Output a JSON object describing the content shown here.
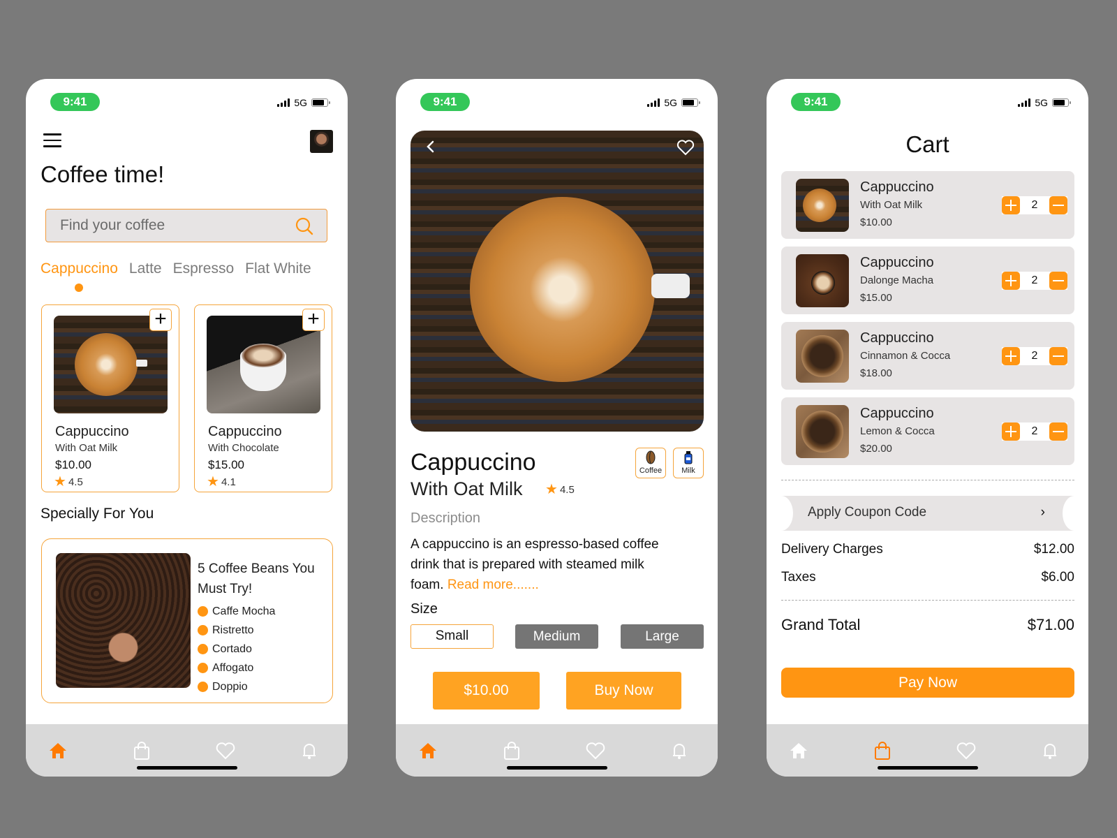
{
  "status_bar": {
    "time": "9:41",
    "network": "5G"
  },
  "colors": {
    "accent": "#ff9512",
    "status_green": "#34c759",
    "card_bg": "#e7e4e4",
    "nav_bg": "#d9d9d9",
    "size_inactive": "#757575"
  },
  "home": {
    "title": "Coffee time!",
    "search": {
      "placeholder": "Find your coffee",
      "value": ""
    },
    "tabs": [
      {
        "label": "Cappuccino",
        "active": true
      },
      {
        "label": "Latte",
        "active": false
      },
      {
        "label": "Espresso",
        "active": false
      },
      {
        "label": "Flat White",
        "active": false
      }
    ],
    "products": [
      {
        "name": "Cappuccino",
        "subtitle": "With Oat Milk",
        "price": "$10.00",
        "rating": "4.5",
        "add_label": "+"
      },
      {
        "name": "Cappuccino",
        "subtitle": "With Chocolate",
        "price": "$15.00",
        "rating": "4.1",
        "add_label": "+"
      }
    ],
    "special_section_title": "Specially For You",
    "special": {
      "title": "5 Coffee Beans You Must Try!",
      "items": [
        "Caffe Mocha",
        "Ristretto",
        "Cortado",
        "Affogato",
        "Doppio"
      ]
    },
    "nav_active": "home"
  },
  "detail": {
    "name": "Cappuccino",
    "subtitle": "With Oat Milk",
    "rating": "4.5",
    "ingredients": [
      {
        "label": "Coffee",
        "icon": "coffee-bean-icon"
      },
      {
        "label": "Milk",
        "icon": "milk-bottle-icon"
      }
    ],
    "description_label": "Description",
    "description": "A cappuccino is an espresso-based coffee drink that  is prepared with steamed milk foam.",
    "read_more": "Read more.......",
    "size_label": "Size",
    "sizes": [
      {
        "label": "Small",
        "selected": true
      },
      {
        "label": "Medium",
        "selected": false
      },
      {
        "label": "Large",
        "selected": false
      }
    ],
    "price_button": "$10.00",
    "buy_button": "Buy Now",
    "nav_active": "home"
  },
  "cart": {
    "title": "Cart",
    "items": [
      {
        "name": "Cappuccino",
        "subtitle": "With Oat Milk",
        "price": "$10.00",
        "qty": "2"
      },
      {
        "name": "Cappuccino",
        "subtitle": "Dalonge Macha",
        "price": "$15.00",
        "qty": "2"
      },
      {
        "name": "Cappuccino",
        "subtitle": "Cinnamon & Cocca",
        "price": "$18.00",
        "qty": "2"
      },
      {
        "name": "Cappuccino",
        "subtitle": "Lemon & Cocca",
        "price": "$20.00",
        "qty": "2"
      }
    ],
    "coupon_label": "Apply Coupon Code",
    "coupon_chevron": "›",
    "delivery_label": "Delivery Charges",
    "delivery_value": "$12.00",
    "taxes_label": "Taxes",
    "taxes_value": "$6.00",
    "grand_total_label": "Grand Total",
    "grand_total_value": "$71.00",
    "pay_button": "Pay Now",
    "nav_active": "bag"
  },
  "nav_items": [
    "home",
    "bag",
    "favorites",
    "notifications"
  ]
}
